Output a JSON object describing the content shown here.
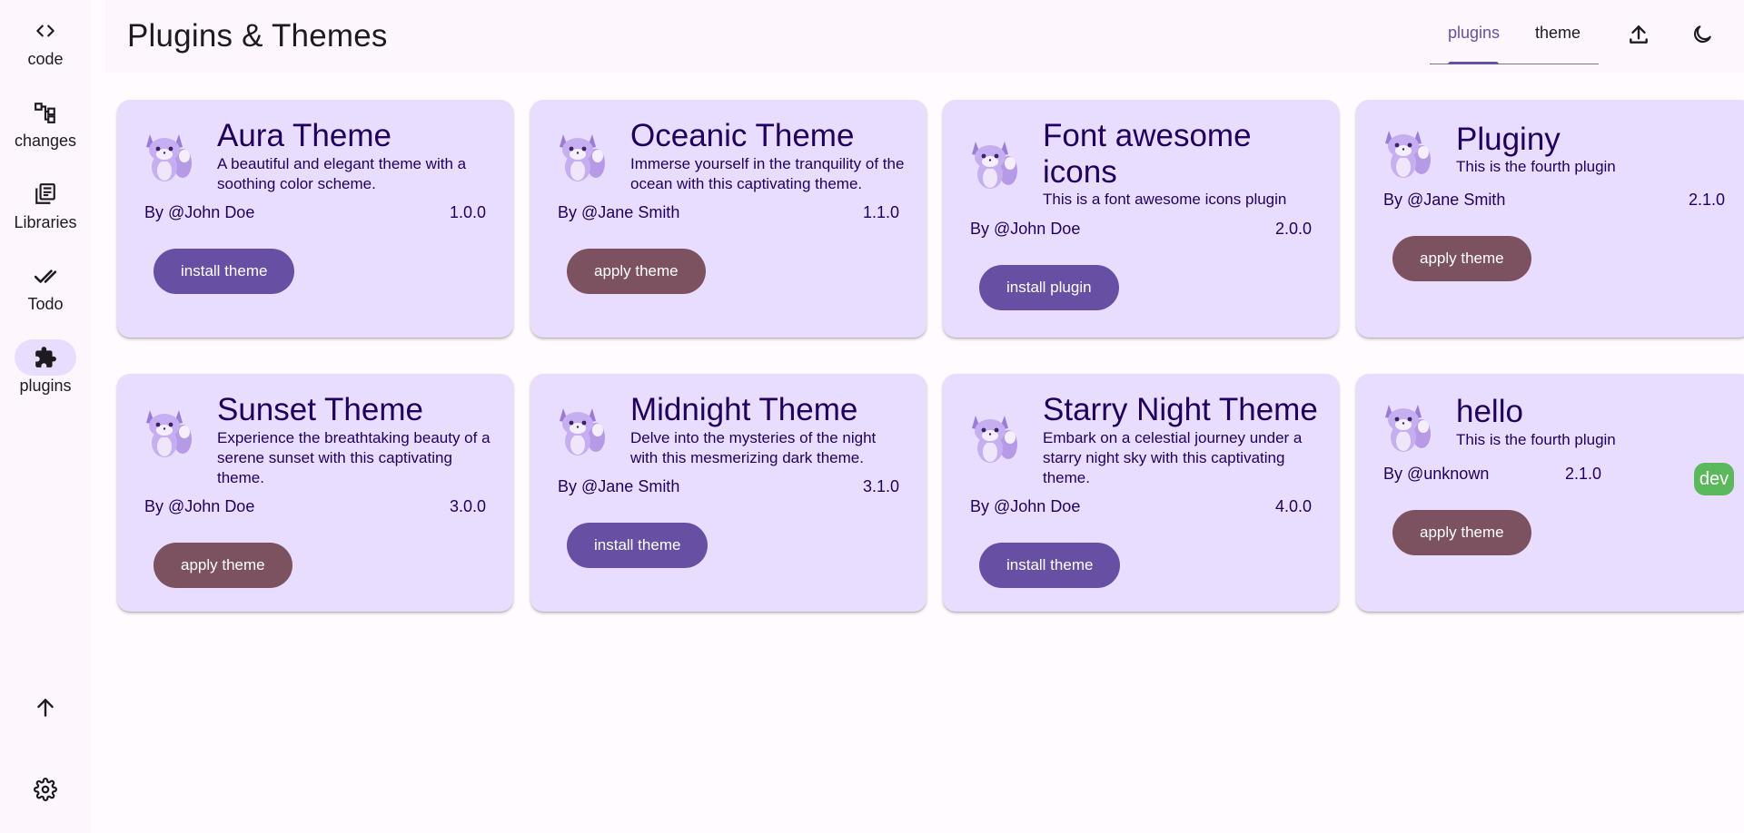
{
  "sidebar": {
    "items": [
      {
        "label": "code",
        "icon": "code-icon"
      },
      {
        "label": "changes",
        "icon": "tree-icon"
      },
      {
        "label": "Libraries",
        "icon": "library-icon"
      },
      {
        "label": "Todo",
        "icon": "check-icon"
      },
      {
        "label": "plugins",
        "icon": "puzzle-icon"
      }
    ],
    "bottom": [
      {
        "icon": "arrow-up-icon"
      },
      {
        "icon": "gear-icon"
      }
    ]
  },
  "header": {
    "title": "Plugins & Themes",
    "tabs": [
      {
        "label": "plugins"
      },
      {
        "label": "theme"
      }
    ],
    "active_tab": "plugins",
    "actions": [
      {
        "icon": "upload-icon"
      },
      {
        "icon": "moon-icon"
      }
    ]
  },
  "colors": {
    "primary": "#6750a4",
    "card_bg": "#e8ddff",
    "install_button": "#6750a4",
    "apply_button": "#7d5260",
    "dev_badge": "#5cb85c",
    "text_on_card": "#21005d"
  },
  "cards": [
    {
      "title": "Aura Theme",
      "description": "A beautiful and elegant theme with a soothing color scheme.",
      "author": "By @John Doe",
      "version": "1.0.0",
      "button": "install theme",
      "button_kind": "install"
    },
    {
      "title": "Oceanic Theme",
      "description": "Immerse yourself in the tranquility of the ocean with this captivating theme.",
      "author": "By @Jane Smith",
      "version": "1.1.0",
      "button": "apply theme",
      "button_kind": "apply"
    },
    {
      "title": "Font awesome icons",
      "description": "This is a font awesome icons plugin",
      "author": "By @John Doe",
      "version": "2.0.0",
      "button": "install plugin",
      "button_kind": "install"
    },
    {
      "title": "Pluginy",
      "description": "This is the fourth plugin",
      "author": "By @Jane Smith",
      "version": "2.1.0",
      "button": "apply theme",
      "button_kind": "apply"
    },
    {
      "title": "Sunset Theme",
      "description": "Experience the breathtaking beauty of a serene sunset with this captivating theme.",
      "author": "By @John Doe",
      "version": "3.0.0",
      "button": "apply theme",
      "button_kind": "apply"
    },
    {
      "title": "Midnight Theme",
      "description": "Delve into the mysteries of the night with this mesmerizing dark theme.",
      "author": "By @Jane Smith",
      "version": "3.1.0",
      "button": "install theme",
      "button_kind": "install"
    },
    {
      "title": "Starry Night Theme",
      "description": "Embark on a celestial journey under a starry night sky with this captivating theme.",
      "author": "By @John Doe",
      "version": "4.0.0",
      "button": "install theme",
      "button_kind": "install"
    },
    {
      "title": "hello",
      "description": "This is the fourth plugin",
      "author": "By @unknown",
      "version": "2.1.0",
      "button": "apply theme",
      "button_kind": "apply",
      "badge": "dev"
    }
  ]
}
